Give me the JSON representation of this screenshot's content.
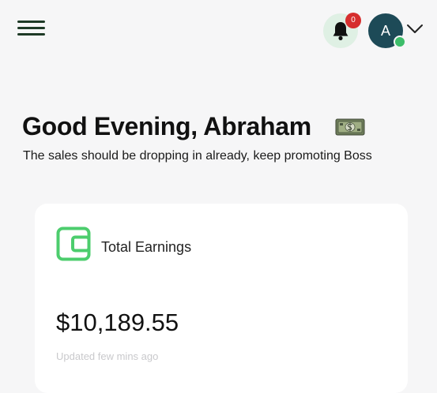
{
  "header": {
    "menu_icon": "hamburger-menu-icon",
    "notifications": {
      "icon": "bell-icon",
      "count": "0"
    },
    "user": {
      "avatar_initial": "A",
      "status": "online",
      "dropdown_icon": "chevron-down-icon"
    }
  },
  "greeting": {
    "title": "Good Evening, Abraham",
    "emoji_icon": "dollar-banknote-icon",
    "subtitle": "The sales should be dropping in already, keep promoting Boss"
  },
  "earnings_card": {
    "icon": "wallet-icon",
    "title": "Total Earnings",
    "amount": "$10,189.55",
    "updated": "Updated few mins ago"
  },
  "colors": {
    "background": "#f6f6f7",
    "menu_icon": "#1e3a26",
    "bell_bg": "#dff0e4",
    "badge": "#d62e2e",
    "avatar": "#1d4a57",
    "online": "#3dbd6a",
    "wallet_accent": "#4ccd6d",
    "muted_text": "#c9c9cc"
  }
}
